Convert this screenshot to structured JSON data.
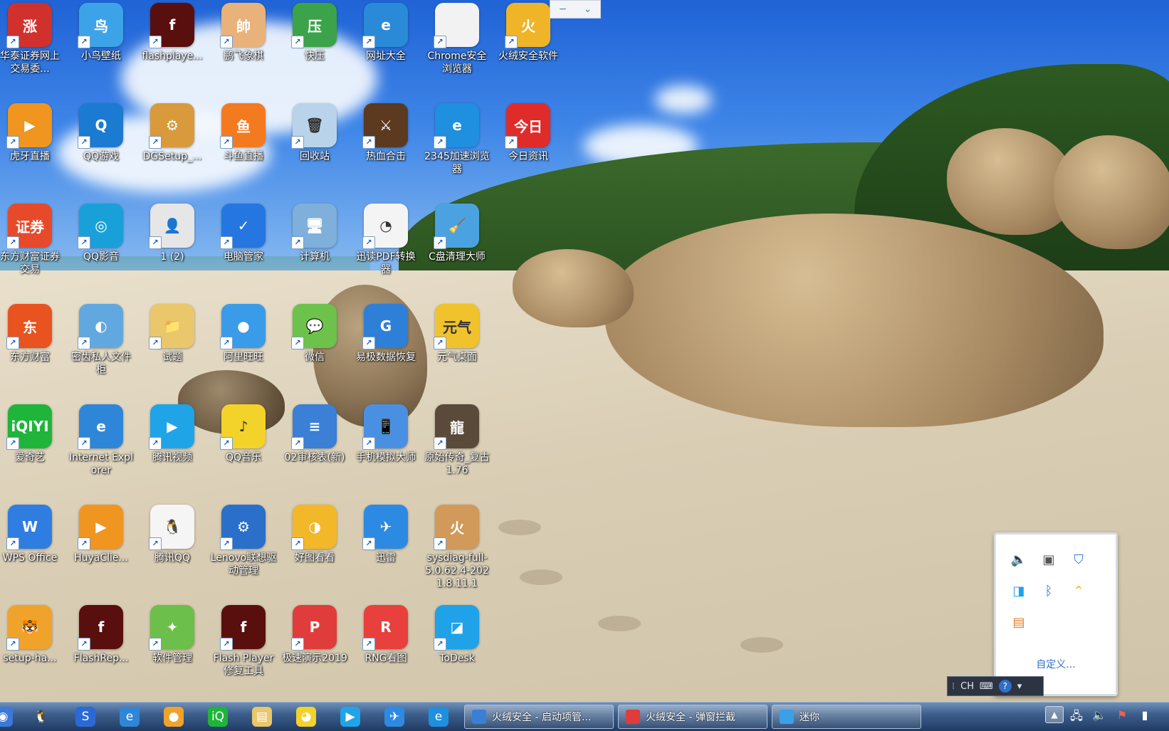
{
  "desktop": {
    "icons": [
      {
        "label": "华泰证券网上交易委...",
        "glyph": "涨",
        "color": "#d0312d",
        "icon": "huatai-icon"
      },
      {
        "label": "小鸟壁纸",
        "glyph": "鸟",
        "color": "#3da3e8",
        "icon": "bird-wallpaper-icon"
      },
      {
        "label": "flashplaye...",
        "glyph": "f",
        "color": "#5a0f0f",
        "icon": "flash-icon"
      },
      {
        "label": "鹏飞象棋",
        "glyph": "帥",
        "color": "#e8b27a",
        "icon": "chess-icon"
      },
      {
        "label": "快压",
        "glyph": "压",
        "color": "#3ca34a",
        "icon": "kuaiya-icon"
      },
      {
        "label": "网址大全",
        "glyph": "e",
        "color": "#2a8ad8",
        "icon": "ie-icon"
      },
      {
        "label": "Chrome安全浏览器",
        "glyph": "",
        "color": "#f2f2f2",
        "icon": "file-icon"
      },
      {
        "label": "火绒安全软件",
        "glyph": "火",
        "color": "#f0b429",
        "icon": "huorong-icon"
      },
      {
        "label": "虎牙直播",
        "glyph": "▶",
        "color": "#f0951f",
        "icon": "huya-icon"
      },
      {
        "label": "QQ游戏",
        "glyph": "Q",
        "color": "#1b7ad1",
        "icon": "qq-game-icon"
      },
      {
        "label": "DGSetup_...",
        "glyph": "⚙",
        "color": "#d99a3c",
        "icon": "setup-box-icon"
      },
      {
        "label": "斗鱼直播",
        "glyph": "鱼",
        "color": "#f47a1f",
        "icon": "douyu-icon"
      },
      {
        "label": "回收站",
        "glyph": "🗑",
        "color": "#b8d3ea",
        "icon": "recycle-bin-icon"
      },
      {
        "label": "热血合击",
        "glyph": "⚔",
        "color": "#5b3a1f",
        "icon": "game-icon"
      },
      {
        "label": "2345加速浏览器",
        "glyph": "e",
        "color": "#1f8fe0",
        "icon": "browser-2345-icon"
      },
      {
        "label": "今日资讯",
        "glyph": "今日",
        "color": "#e02b2b",
        "icon": "news-icon"
      },
      {
        "label": "东方财富证券交易",
        "glyph": "证券",
        "color": "#e74a2a",
        "icon": "eastmoney-trade-icon"
      },
      {
        "label": "QQ影音",
        "glyph": "◎",
        "color": "#1aa0d8",
        "icon": "qq-player-icon"
      },
      {
        "label": "1 (2)",
        "glyph": "👤",
        "color": "#e6e6e6",
        "icon": "photo-icon"
      },
      {
        "label": "电脑管家",
        "glyph": "✓",
        "color": "#2576e0",
        "icon": "pc-manager-icon"
      },
      {
        "label": "计算机",
        "glyph": "🖥",
        "color": "#7fb0dc",
        "icon": "computer-icon"
      },
      {
        "label": "迅读PDF转换器",
        "glyph": "◔",
        "color": "#f4f4f4",
        "icon": "pdf-converter-icon"
      },
      {
        "label": "C盘清理大师",
        "glyph": "🧹",
        "color": "#4aa3e0",
        "icon": "cleaner-icon"
      },
      {
        "label": "东方财富",
        "glyph": "东",
        "color": "#e8531f",
        "icon": "eastmoney-icon"
      },
      {
        "label": "密齿私人文件柜",
        "glyph": "◐",
        "color": "#62a8e0",
        "icon": "private-cabinet-icon"
      },
      {
        "label": "试题",
        "glyph": "📁",
        "color": "#e9c76a",
        "icon": "folder-icon"
      },
      {
        "label": "阿里旺旺",
        "glyph": "●",
        "color": "#3a9be8",
        "icon": "aliwangwang-icon"
      },
      {
        "label": "微信",
        "glyph": "💬",
        "color": "#6cc24a",
        "icon": "wechat-icon"
      },
      {
        "label": "易极数据恢复",
        "glyph": "G",
        "color": "#2d7fd8",
        "icon": "data-recovery-icon"
      },
      {
        "label": "元气桌面",
        "glyph": "元气",
        "color": "#f0c22c",
        "icon": "yuanqi-icon"
      },
      {
        "label": "爱奇艺",
        "glyph": "iQIYI",
        "color": "#1fb53a",
        "icon": "iqiyi-icon"
      },
      {
        "label": "Internet Explorer",
        "glyph": "e",
        "color": "#2e86d8",
        "icon": "internet-explorer-icon"
      },
      {
        "label": "腾讯视频",
        "glyph": "▶",
        "color": "#20a4e8",
        "icon": "tencent-video-icon"
      },
      {
        "label": "QQ音乐",
        "glyph": "♪",
        "color": "#f3d22a",
        "icon": "qq-music-icon"
      },
      {
        "label": "02审核表(新)",
        "glyph": "≡",
        "color": "#3b7fd6",
        "icon": "document-icon"
      },
      {
        "label": "手机模拟大师",
        "glyph": "📱",
        "color": "#4a90e2",
        "icon": "phone-emulator-icon"
      },
      {
        "label": "原始传奇_复古1.76",
        "glyph": "龍",
        "color": "#5a4a3a",
        "icon": "legend-game-icon"
      },
      {
        "label": "WPS Office",
        "glyph": "W",
        "color": "#2f7de0",
        "icon": "wps-icon"
      },
      {
        "label": "HuyaClie...",
        "glyph": "▶",
        "color": "#f0951f",
        "icon": "huya-client-icon"
      },
      {
        "label": "腾讯QQ",
        "glyph": "🐧",
        "color": "#f5f5f5",
        "icon": "qq-icon"
      },
      {
        "label": "Lenovo联想驱动管理",
        "glyph": "⚙",
        "color": "#2a6fc9",
        "icon": "lenovo-driver-icon"
      },
      {
        "label": "好图看看",
        "glyph": "◑",
        "color": "#f2b829",
        "icon": "image-viewer-icon"
      },
      {
        "label": "迅雷",
        "glyph": "✈",
        "color": "#2d8ae3",
        "icon": "xunlei-icon"
      },
      {
        "label": "sysdiag-full-5.0.62.4-2021.8.11.1",
        "glyph": "火",
        "color": "#d19a5a",
        "icon": "installer-icon"
      },
      {
        "label": "setup-ha...",
        "glyph": "🐯",
        "color": "#f0a32a",
        "icon": "setup-ha-icon"
      },
      {
        "label": "FlashRep...",
        "glyph": "f",
        "color": "#5a0f0f",
        "icon": "flash-repair-icon"
      },
      {
        "label": "软件管理",
        "glyph": "✦",
        "color": "#6bbf4a",
        "icon": "software-manager-icon"
      },
      {
        "label": "Flash Player修复工具",
        "glyph": "f",
        "color": "#5a0f0f",
        "icon": "flash-player-fix-icon"
      },
      {
        "label": "极速演示2019",
        "glyph": "P",
        "color": "#e03c3c",
        "icon": "presentation-icon"
      },
      {
        "label": "RNG看图",
        "glyph": "R",
        "color": "#e8403c",
        "icon": "rng-viewer-icon"
      },
      {
        "label": "ToDesk",
        "glyph": "◪",
        "color": "#1fa2e8",
        "icon": "todesk-icon"
      }
    ]
  },
  "mini_widget": {
    "min": "−",
    "chevron": "⌄"
  },
  "tray_popup": {
    "items": [
      {
        "glyph": "🔈",
        "icon": "speaker-icon"
      },
      {
        "glyph": "▣",
        "icon": "display-icon"
      },
      {
        "glyph": "⛉",
        "icon": "shield-icon"
      },
      {
        "glyph": "◨",
        "icon": "todesk-tray-icon"
      },
      {
        "glyph": "ᛒ",
        "icon": "bluetooth-icon"
      },
      {
        "glyph": "⌃",
        "icon": "huorong-tray-icon"
      },
      {
        "glyph": "▤",
        "icon": "calendar-icon"
      }
    ],
    "customize": "自定义..."
  },
  "langbar": {
    "lang": "CH",
    "help": "?"
  },
  "taskbar": {
    "quick": [
      {
        "glyph": "◉",
        "color": "#3b78d8",
        "icon": "start-orb-icon"
      },
      {
        "glyph": "🐧",
        "color": "transparent",
        "icon": "qq-taskbar-icon"
      },
      {
        "glyph": "S",
        "color": "#2b6ad6",
        "icon": "sogou-icon"
      },
      {
        "glyph": "e",
        "color": "#2e86d8",
        "icon": "ie-taskbar-icon"
      },
      {
        "glyph": "●",
        "color": "#f0a32a",
        "icon": "huya-taskbar-icon"
      },
      {
        "glyph": "iQ",
        "color": "#1fb53a",
        "icon": "iqiyi-taskbar-icon"
      },
      {
        "glyph": "▤",
        "color": "#e9c76a",
        "icon": "explorer-icon"
      },
      {
        "glyph": "◕",
        "color": "#f3d22a",
        "icon": "qq-music-taskbar-icon"
      },
      {
        "glyph": "▶",
        "color": "#20a4e8",
        "icon": "tencent-video-taskbar-icon"
      },
      {
        "glyph": "✈",
        "color": "#2d8ae3",
        "icon": "xunlei-taskbar-icon"
      },
      {
        "glyph": "e",
        "color": "#1f8fe0",
        "icon": "browser-taskbar-icon"
      }
    ],
    "tasks": [
      {
        "label": "火绒安全 - 启动项管...",
        "color": "#3a7fd6"
      },
      {
        "label": "火绒安全 - 弹窗拦截",
        "color": "#e03c3c"
      },
      {
        "label": "迷你",
        "color": "#3aa0e8"
      }
    ],
    "tray": [
      {
        "glyph": "▲",
        "icon": "show-hidden-icons-icon"
      },
      {
        "glyph": "🖧",
        "icon": "network-icon"
      },
      {
        "glyph": "🔈",
        "icon": "volume-icon"
      },
      {
        "glyph": "⚑",
        "icon": "action-center-icon"
      },
      {
        "glyph": "▮",
        "icon": "signal-icon"
      }
    ]
  }
}
